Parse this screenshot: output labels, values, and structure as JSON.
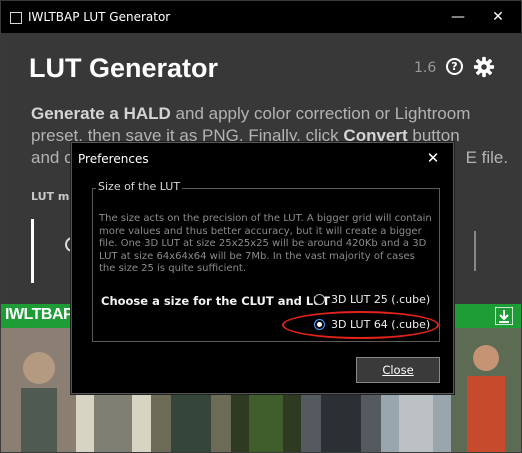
{
  "window": {
    "title": "IWLTBAP LUT Generator",
    "controls": {
      "minimize": "—",
      "close": "✕"
    }
  },
  "main": {
    "heading": "LUT Generator",
    "version": "1.6",
    "help_icon": "?",
    "description": {
      "line1_bold": "Generate a HALD",
      "line1_rest": " and apply color correction or Lightroom",
      "line2_pre": "preset, then save it as PNG. Finally, click ",
      "line2_bold": "Convert",
      "line2_post": " button",
      "line3_pre": "and c",
      "line3_post": "E file."
    },
    "lut_label": "LUT ma"
  },
  "gallery": {
    "brand": "IWLTBAP",
    "accent_color": "#1e9c35"
  },
  "dialog": {
    "title": "Preferences",
    "close_icon": "✕",
    "group": {
      "legend": "Size of the LUT",
      "text": "The size acts on the precision of the LUT. A bigger grid will contain more values and thus better accuracy, but it will create a bigger file. One 3D LUT at size 25x25x25 will be around 420Kb and a 3D LUT at size 64x64x64 will be 7Mb. In the vast majority of cases the size 25 is quite sufficient.",
      "choose_label": "Choose a size for the CLUT and LUT",
      "options": [
        {
          "label": "3D LUT 25 (.cube)",
          "selected": false
        },
        {
          "label": "3D LUT 64 (.cube)",
          "selected": true
        }
      ]
    },
    "close_button": "Close"
  },
  "annotation": {
    "color": "#e2231a"
  }
}
